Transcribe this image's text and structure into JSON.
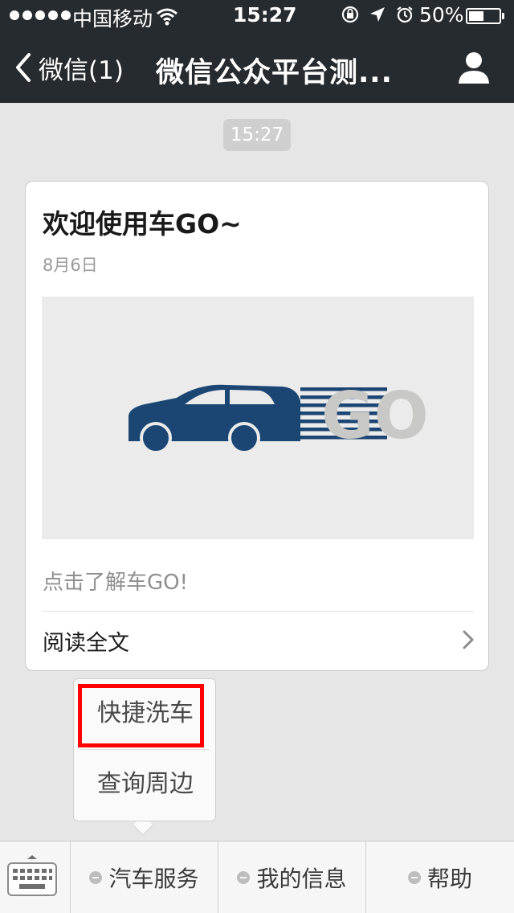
{
  "status_bar": {
    "carrier": "中国移动",
    "time": "15:27",
    "battery": "50%",
    "battery_level": 0.5,
    "icons": [
      "signal-dots-icon",
      "wifi-icon",
      "rotation-lock-icon",
      "location-arrow-icon",
      "alarm-icon",
      "battery-icon"
    ]
  },
  "nav": {
    "back_label": "微信(1)",
    "title": "微信公众平台测...",
    "back_icon": "chevron-left-icon",
    "profile_icon": "person-icon"
  },
  "chat": {
    "timestamp": "15:27",
    "article": {
      "title": "欢迎使用车GO~",
      "date": "8月6日",
      "image_text": "GO",
      "description": "点击了解车GO!",
      "read_more": "阅读全文",
      "brand_color": "#1b4573"
    }
  },
  "popup_menu": {
    "items": [
      "快捷洗车",
      "查询周边"
    ],
    "highlighted_index": 0,
    "highlight_color": "#ff0000"
  },
  "bottom_menu": {
    "keyboard_icon": "keyboard-icon",
    "tabs": [
      "汽车服务",
      "我的信息",
      "帮助"
    ]
  }
}
